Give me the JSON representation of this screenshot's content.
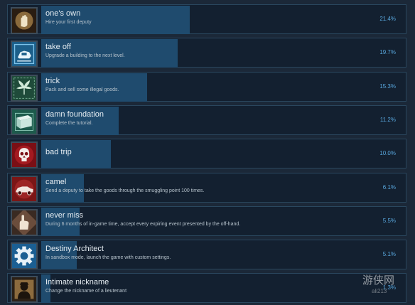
{
  "achievements": [
    {
      "title": "one's own",
      "description": "Hire your first deputy",
      "percent_label": "21.4%",
      "percent": 21.4,
      "icon": "hand-icon"
    },
    {
      "title": "take off",
      "description": "Upgrade a building to the next level.",
      "percent_label": "19.7%",
      "percent": 19.7,
      "icon": "building-icon"
    },
    {
      "title": "trick",
      "description": "Pack and sell some illegal goods.",
      "percent_label": "15.3%",
      "percent": 15.3,
      "icon": "leaf-icon"
    },
    {
      "title": "damn foundation",
      "description": "Complete the tutorial.",
      "percent_label": "11.2%",
      "percent": 11.2,
      "icon": "crate-icon"
    },
    {
      "title": "bad trip",
      "description": "",
      "percent_label": "10.0%",
      "percent": 10.0,
      "icon": "skull-icon"
    },
    {
      "title": "camel",
      "description": "Send a deputy to take the goods through the smuggling point 100 times.",
      "percent_label": "6.1%",
      "percent": 6.1,
      "icon": "car-icon"
    },
    {
      "title": "never miss",
      "description": "During 6 months of in-game time, accept every expiring event presented by the off-hand.",
      "percent_label": "5.5%",
      "percent": 5.5,
      "icon": "pointing-hand-icon"
    },
    {
      "title": "Destiny Architect",
      "description": "In sandbox mode, launch the game with custom settings.",
      "percent_label": "5.1%",
      "percent": 5.1,
      "icon": "gear-icon"
    },
    {
      "title": "Intimate nickname",
      "description": "Change the nickname of a lieutenant",
      "percent_label": "1.3%",
      "percent": 1.3,
      "icon": "silhouette-icon"
    }
  ],
  "watermark": {
    "text": "游侠网",
    "subtext": "ali213"
  },
  "colors": {
    "background": "#1b2838",
    "row": "#132030",
    "bar": "#1f4b6e",
    "percent": "#58a6dc"
  }
}
